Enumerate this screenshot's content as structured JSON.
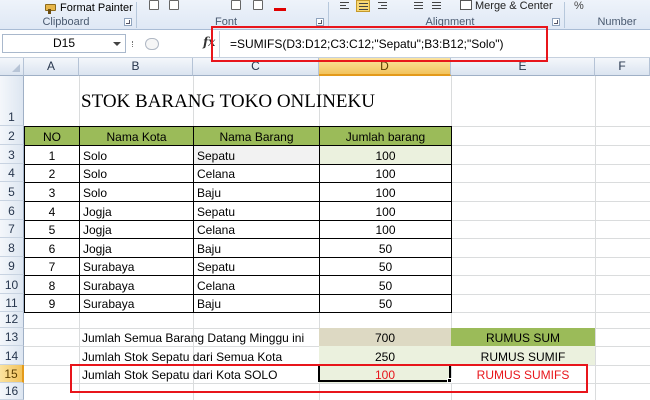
{
  "ribbon": {
    "format_painter": "Format Painter",
    "groups": {
      "clipboard": "Clipboard",
      "font": "Font",
      "alignment": "Alignment",
      "number": "Number"
    },
    "merge_label": "Merge & Center",
    "number_format": "%"
  },
  "formula_bar": {
    "name_box": "D15",
    "fx": "fx",
    "formula": "=SUMIFS(D3:D12;C3:C12;\"Sepatu\";B3:B12;\"Solo\")"
  },
  "columns": [
    "A",
    "B",
    "C",
    "D",
    "E",
    "F"
  ],
  "rows": [
    "1",
    "2",
    "3",
    "4",
    "5",
    "6",
    "7",
    "8",
    "9",
    "10",
    "11",
    "12",
    "13",
    "14",
    "15",
    "16"
  ],
  "sheet": {
    "title": "STOK BARANG TOKO ONLINEKU",
    "headers": {
      "no": "NO",
      "city": "Nama Kota",
      "item": "Nama Barang",
      "qty": "Jumlah barang"
    },
    "data": [
      {
        "no": "1",
        "city": "Solo",
        "item": "Sepatu",
        "qty": "100"
      },
      {
        "no": "2",
        "city": "Solo",
        "item": "Celana",
        "qty": "100"
      },
      {
        "no": "3",
        "city": "Solo",
        "item": "Baju",
        "qty": "100"
      },
      {
        "no": "4",
        "city": "Jogja",
        "item": "Sepatu",
        "qty": "100"
      },
      {
        "no": "5",
        "city": "Jogja",
        "item": "Celana",
        "qty": "100"
      },
      {
        "no": "6",
        "city": "Jogja",
        "item": "Baju",
        "qty": "50"
      },
      {
        "no": "7",
        "city": "Surabaya",
        "item": "Sepatu",
        "qty": "50"
      },
      {
        "no": "8",
        "city": "Surabaya",
        "item": "Celana",
        "qty": "50"
      },
      {
        "no": "9",
        "city": "Surabaya",
        "item": "Baju",
        "qty": "50"
      }
    ],
    "summary": [
      {
        "label": "Jumlah Semua Barang Datang Minggu ini",
        "value": "700",
        "rumus": "RUMUS SUM"
      },
      {
        "label": "Jumlah Stok Sepatu dari Semua Kota",
        "value": "250",
        "rumus": "RUMUS SUMIF"
      },
      {
        "label": "Jumlah Stok Sepatu dari Kota SOLO",
        "value": "100",
        "rumus": "RUMUS SUMIFS"
      }
    ]
  },
  "colors": {
    "header_green": "#9bbb59",
    "highlight_red": "#e8151b",
    "active_orange": "#f2c35d"
  }
}
